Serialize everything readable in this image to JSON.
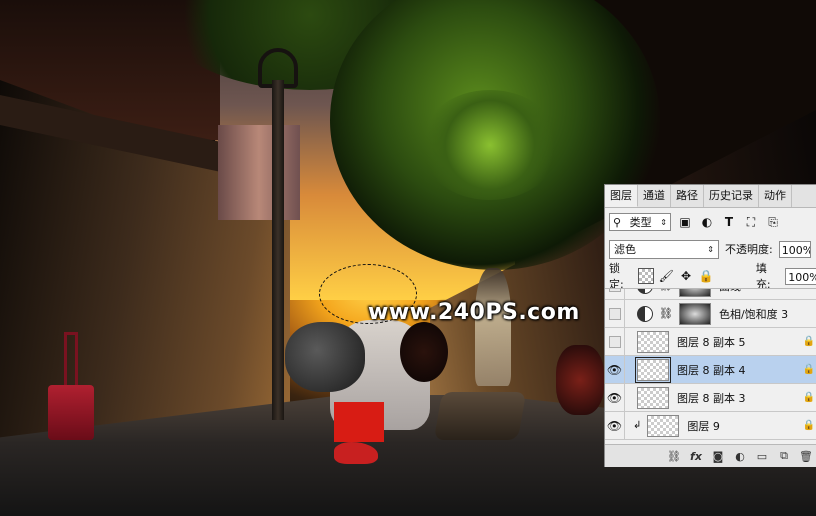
{
  "watermark": "www.240PS.com",
  "panel": {
    "tabs": [
      "图层",
      "通道",
      "路径",
      "历史记录",
      "动作"
    ],
    "active_tab": "图层",
    "filter_type": "类型",
    "filter_icons": [
      "image-filter-icon",
      "adjustment-filter-icon",
      "text-filter-icon",
      "shape-filter-icon",
      "smart-object-filter-icon"
    ],
    "blend_mode": "滤色",
    "opacity_label": "不透明度:",
    "opacity_value": "100%",
    "lock_label": "锁定:",
    "fill_label": "填充:",
    "fill_value": "100%",
    "layers": [
      {
        "name": "曲线",
        "visible": false,
        "type": "adjustment"
      },
      {
        "name": "色相/饱和度 3",
        "visible": false,
        "type": "adjustment"
      },
      {
        "name": "图层 8 副本 5",
        "visible": false,
        "type": "pixel"
      },
      {
        "name": "图层 8 副本 4",
        "visible": true,
        "type": "pixel",
        "selected": true
      },
      {
        "name": "图层 8 副本 3",
        "visible": true,
        "type": "pixel"
      },
      {
        "name": "图层 9",
        "visible": true,
        "type": "pixel",
        "clipped": true
      }
    ],
    "bottom_icons": [
      "link-icon",
      "fx-icon",
      "mask-icon",
      "adjustment-icon",
      "folder-icon",
      "new-layer-icon",
      "trash-icon"
    ],
    "fx_label": "fx"
  },
  "colors": {
    "panel_bg": "#f0f0f0",
    "selected_layer": "#b9d1ee"
  }
}
